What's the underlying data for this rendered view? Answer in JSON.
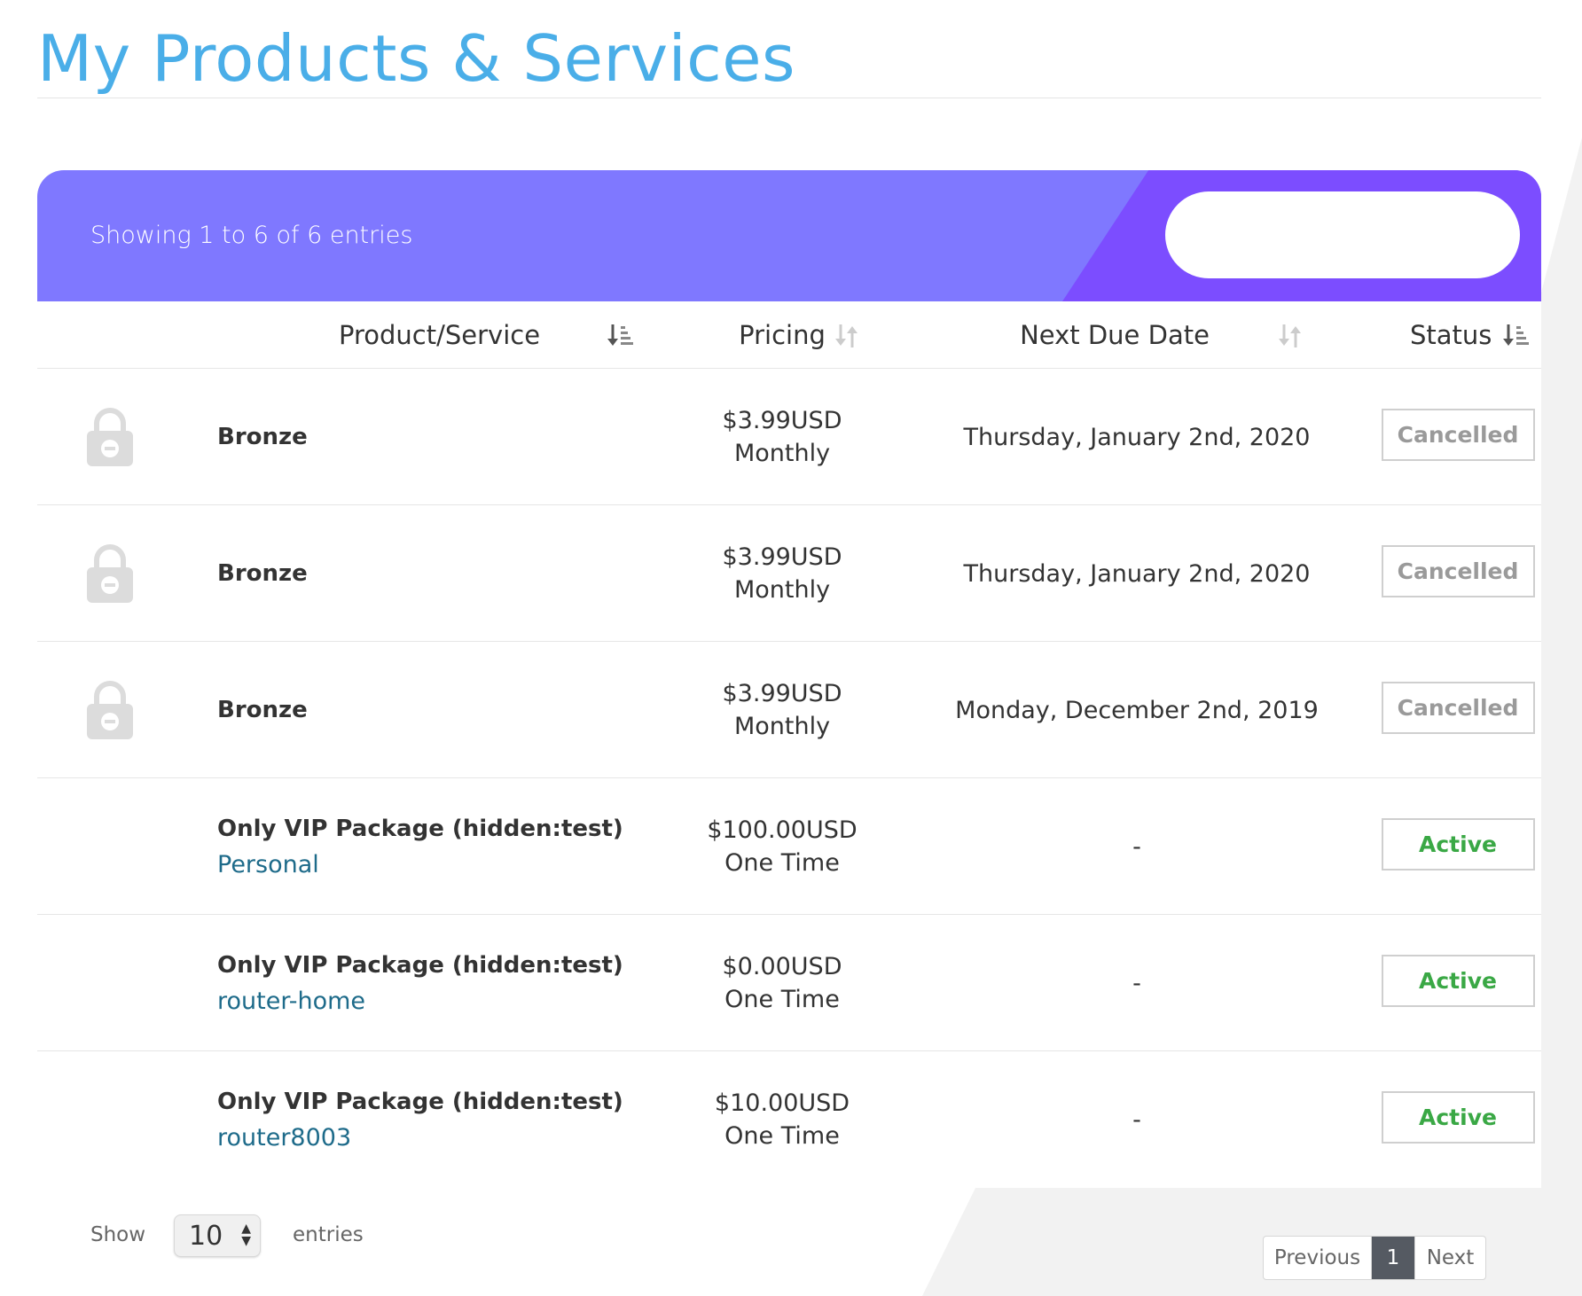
{
  "page": {
    "title": "My Products & Services"
  },
  "table": {
    "info": "Showing 1 to 6 of 6 entries",
    "search": {
      "placeholder": "",
      "value": ""
    },
    "columns": [
      {
        "label": "Product/Service",
        "sort": "sort-amount-desc-icon"
      },
      {
        "label": "Pricing",
        "sort": "sort-icon"
      },
      {
        "label": "Next Due Date",
        "sort": "sort-icon"
      },
      {
        "label": "Status",
        "sort": "sort-amount-desc-icon"
      }
    ],
    "rows": [
      {
        "locked": true,
        "product": "Bronze",
        "domain": "",
        "price": "$3.99USD",
        "cycle": "Monthly",
        "due": "Thursday, January 2nd, 2020",
        "status": "Cancelled"
      },
      {
        "locked": true,
        "product": "Bronze",
        "domain": "",
        "price": "$3.99USD",
        "cycle": "Monthly",
        "due": "Thursday, January 2nd, 2020",
        "status": "Cancelled"
      },
      {
        "locked": true,
        "product": "Bronze",
        "domain": "",
        "price": "$3.99USD",
        "cycle": "Monthly",
        "due": "Monday, December 2nd, 2019",
        "status": "Cancelled"
      },
      {
        "locked": false,
        "product": "Only VIP Package (hidden:test)",
        "domain": "Personal",
        "price": "$100.00USD",
        "cycle": "One Time",
        "due": "-",
        "status": "Active"
      },
      {
        "locked": false,
        "product": "Only VIP Package (hidden:test)",
        "domain": "router-home",
        "price": "$0.00USD",
        "cycle": "One Time",
        "due": "-",
        "status": "Active"
      },
      {
        "locked": false,
        "product": "Only VIP Package (hidden:test)",
        "domain": "router8003",
        "price": "$10.00USD",
        "cycle": "One Time",
        "due": "-",
        "status": "Active"
      }
    ]
  },
  "footer": {
    "show_label": "Show",
    "length_value": "10",
    "entries_label": "entries",
    "pagination": {
      "previous": "Previous",
      "current": "1",
      "next": "Next"
    }
  },
  "colors": {
    "title": "#4aaee8",
    "header_bg": "#7f78ff",
    "header_accent": "#7c4dff",
    "active": "#3aa845",
    "cancelled": "#9a9a9a",
    "link": "#1e6b8a"
  }
}
